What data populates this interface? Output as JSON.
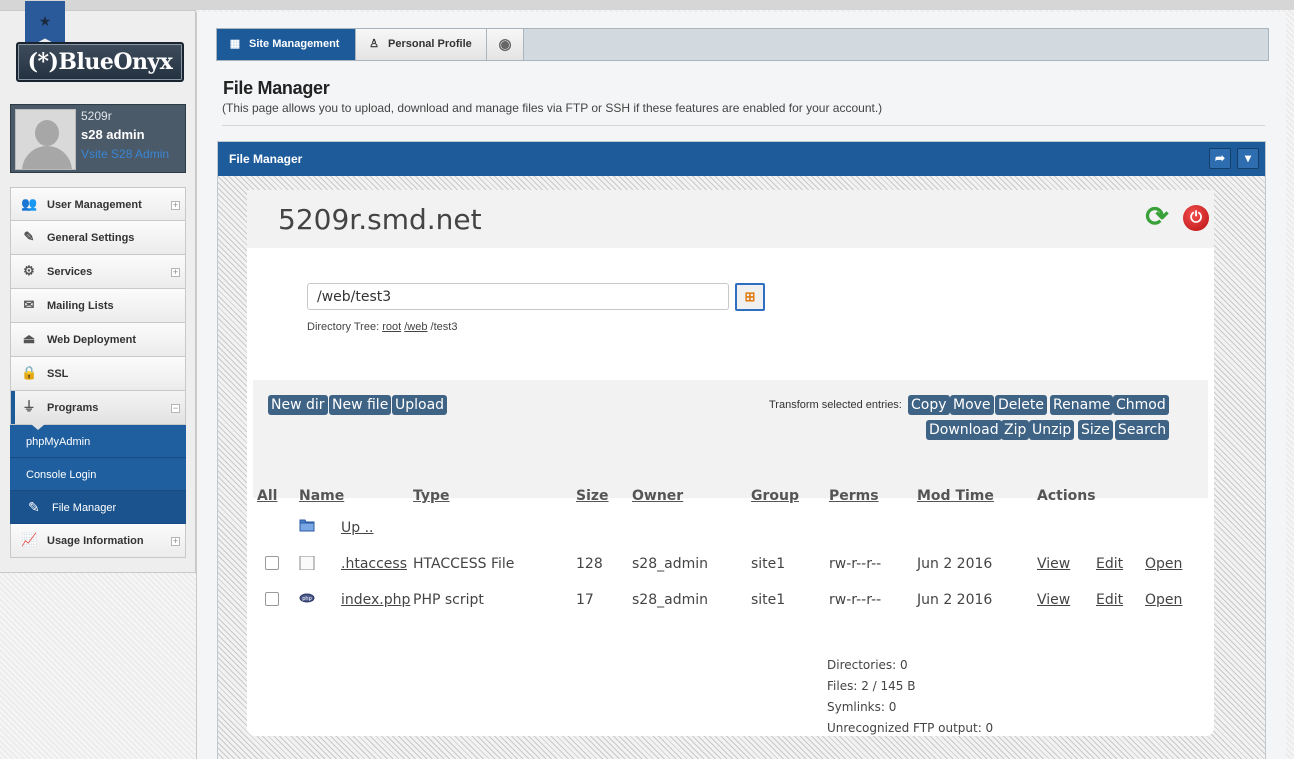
{
  "brand": {
    "logo_text": "(*)BlueOnyx"
  },
  "user": {
    "username": "5209r",
    "fullname": "s28 admin",
    "site_link": "Vsite S28 Admin"
  },
  "sidebar": {
    "items": [
      {
        "label": "User Management",
        "icon": "users-icon",
        "expandable": true
      },
      {
        "label": "General Settings",
        "icon": "edit-icon",
        "expandable": false
      },
      {
        "label": "Services",
        "icon": "gear-icon",
        "expandable": true
      },
      {
        "label": "Mailing Lists",
        "icon": "mail-icon",
        "expandable": false
      },
      {
        "label": "Web Deployment",
        "icon": "deploy-icon",
        "expandable": false
      },
      {
        "label": "SSL",
        "icon": "lock-icon",
        "expandable": false
      },
      {
        "label": "Programs",
        "icon": "plug-icon",
        "expandable": true,
        "expanded": true
      },
      {
        "label": "Usage Information",
        "icon": "chart-icon",
        "expandable": true
      }
    ],
    "sub_items": [
      {
        "label": "phpMyAdmin"
      },
      {
        "label": "Console Login"
      },
      {
        "label": "File Manager",
        "current": true
      }
    ],
    "expand_symbol": "+",
    "collapse_symbol": "−"
  },
  "tabs": [
    {
      "label": "Site Management",
      "active": true
    },
    {
      "label": "Personal Profile",
      "active": false
    },
    {
      "label": "",
      "icon": "disc-icon"
    }
  ],
  "page": {
    "title": "File Manager",
    "description": "(This page allows you to upload, download and manage files via FTP or SSH if these features are enabled for your account.)"
  },
  "panel": {
    "title": "File Manager"
  },
  "file_manager": {
    "host": "5209r.smd.net",
    "path": "/web/test3",
    "dir_tree_label": "Directory Tree:",
    "dir_tree": [
      "root",
      "/web",
      "/test3"
    ],
    "left_buttons": [
      "New dir",
      "New file",
      "Upload"
    ],
    "transform_label": "Transform selected entries:",
    "transform_row1": [
      "Copy",
      "Move",
      "Delete",
      "Rename",
      "Chmod"
    ],
    "transform_row2": [
      "Download",
      "Zip",
      "Unzip",
      "Size",
      "Search"
    ],
    "columns": [
      "All",
      "Name",
      "Type",
      "Size",
      "Owner",
      "Group",
      "Perms",
      "Mod Time",
      "Actions"
    ],
    "up_label": "Up ..",
    "rows": [
      {
        "name": ".htaccess",
        "type": "HTACCESS File",
        "size": "128",
        "owner": "s28_admin",
        "group": "site1",
        "perms": "rw-r--r--",
        "mtime": "Jun 2 2016",
        "actions": [
          "View",
          "Edit",
          "Open"
        ],
        "icon": "file-icon"
      },
      {
        "name": "index.php",
        "type": "PHP script",
        "size": "17",
        "owner": "s28_admin",
        "group": "site1",
        "perms": "rw-r--r--",
        "mtime": "Jun 2 2016",
        "actions": [
          "View",
          "Edit",
          "Open"
        ],
        "icon": "php-icon"
      }
    ],
    "stats": {
      "directories": "Directories: 0",
      "files": "Files: 2 / 145 B",
      "symlinks": "Symlinks: 0",
      "unrecognized": "Unrecognized FTP output: 0"
    }
  },
  "colors": {
    "brand_blue": "#1e5b9b",
    "button_blue": "#3f6385",
    "sub_nav": "#1f5f9f"
  }
}
